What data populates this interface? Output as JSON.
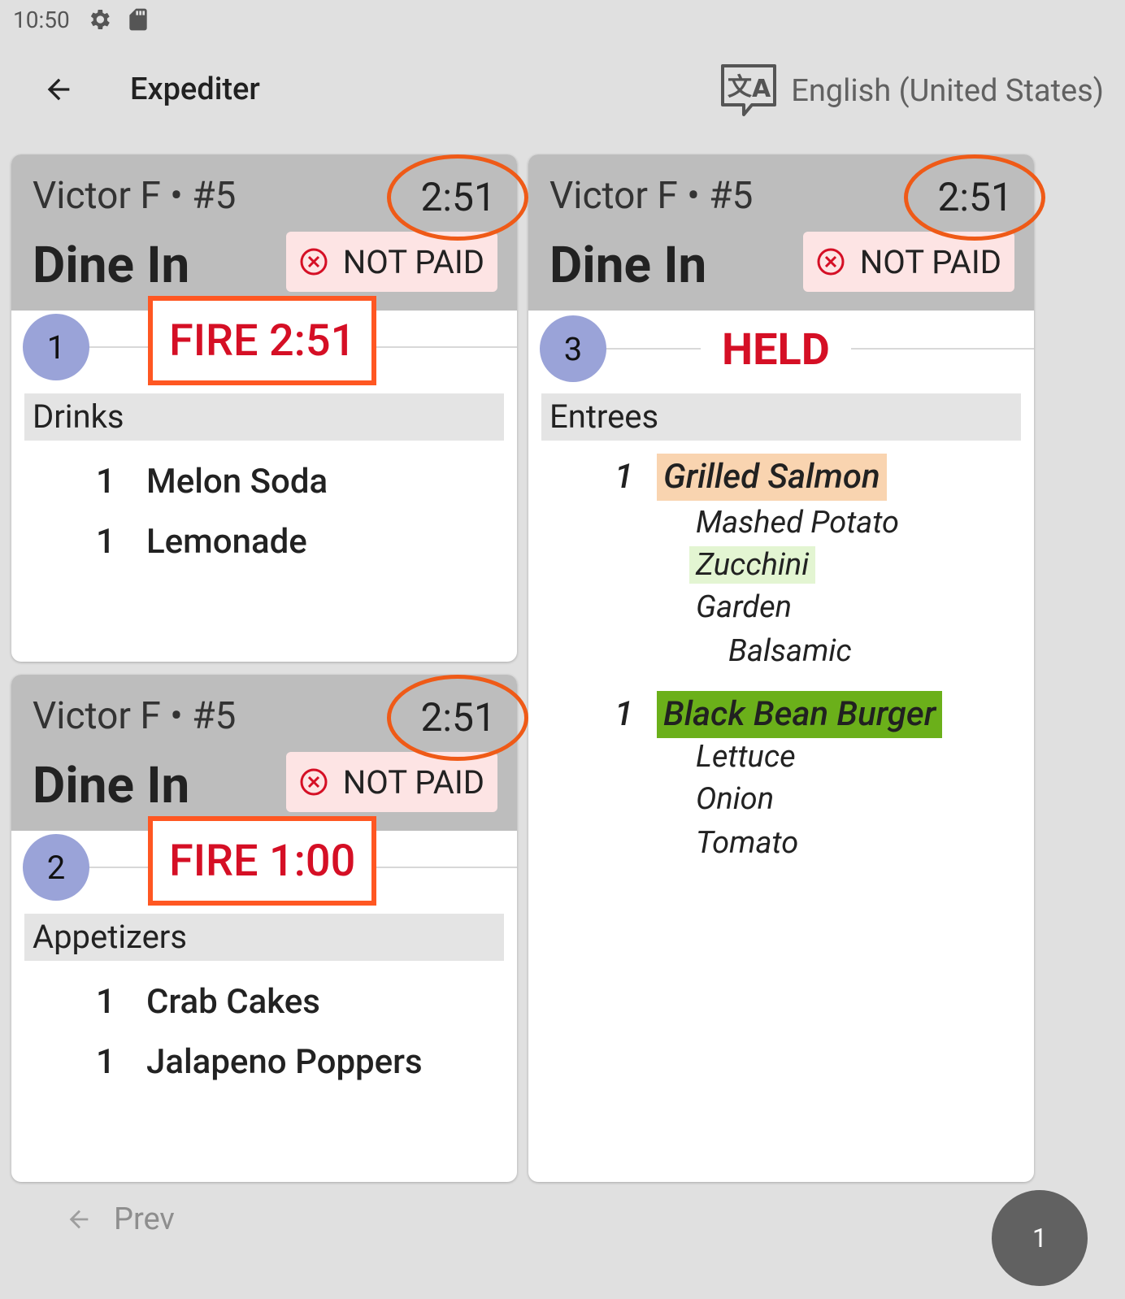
{
  "status_bar": {
    "time": "10:50",
    "icons": [
      "gear-icon",
      "sd-card-icon"
    ]
  },
  "toolbar": {
    "title": "Expediter",
    "back_icon": "arrow-back-icon",
    "language_icon": "translate-icon",
    "language_label": "English (United States)"
  },
  "colors": {
    "header_bg": "#bdbdbd",
    "fire_border": "#ff5722",
    "alert_red": "#d50f25",
    "timer_ring": "#ef5a17",
    "course_badge": "#9aa3d8",
    "not_paid_bg": "#fde4e4",
    "salmon_highlight": "#f9d4b0",
    "zucchini_highlight": "#e3f5d2",
    "burger_highlight": "#6bb01a"
  },
  "tickets": [
    {
      "customer": "Victor F",
      "separator": "•",
      "table": "#5",
      "timer": "2:51",
      "order_type": "Dine In",
      "payment_status": "NOT PAID",
      "course_number": "1",
      "course_status": "FIRE 2:51",
      "category": "Drinks",
      "items": [
        {
          "qty": "1",
          "name": "Melon Soda"
        },
        {
          "qty": "1",
          "name": "Lemonade"
        }
      ]
    },
    {
      "customer": "Victor F",
      "separator": "•",
      "table": "#5",
      "timer": "2:51",
      "order_type": "Dine In",
      "payment_status": "NOT PAID",
      "course_number": "2",
      "course_status": "FIRE 1:00",
      "category": "Appetizers",
      "items": [
        {
          "qty": "1",
          "name": "Crab Cakes"
        },
        {
          "qty": "1",
          "name": "Jalapeno Poppers"
        }
      ]
    },
    {
      "customer": "Victor F",
      "separator": "•",
      "table": "#5",
      "timer": "2:51",
      "order_type": "Dine In",
      "payment_status": "NOT PAID",
      "course_number": "3",
      "course_status": "HELD",
      "category": "Entrees",
      "items": [
        {
          "qty": "1",
          "name": "Grilled Salmon",
          "modifiers": [
            "Mashed Potato",
            "Zucchini",
            "Garden",
            "Balsamic"
          ]
        },
        {
          "qty": "1",
          "name": "Black Bean Burger",
          "modifiers": [
            "Lettuce",
            "Onion",
            "Tomato"
          ]
        }
      ]
    }
  ],
  "footer": {
    "prev_label": "Prev",
    "page_number": "1"
  }
}
